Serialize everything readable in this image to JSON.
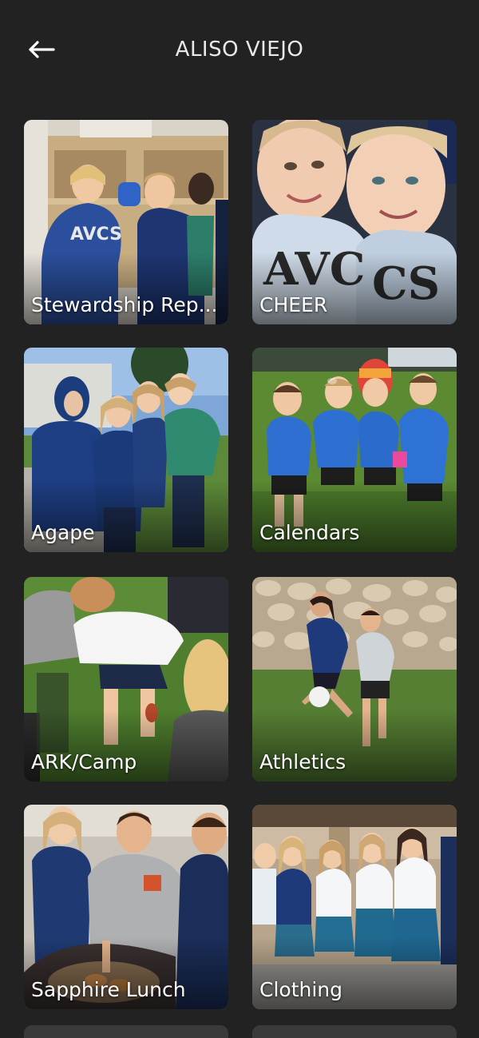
{
  "header": {
    "back_icon": "arrow-left-icon",
    "title": "ALISO VIEJO"
  },
  "tiles": [
    {
      "label": "Stewardship Rep..."
    },
    {
      "label": "CHEER"
    },
    {
      "label": "Agape"
    },
    {
      "label": "Calendars"
    },
    {
      "label": "ARK/Camp"
    },
    {
      "label": "Athletics"
    },
    {
      "label": "Sapphire Lunch"
    },
    {
      "label": "Clothing"
    }
  ],
  "colors": {
    "background": "#222222",
    "title_text": "#e9e9e9",
    "label_text": "#ffffff",
    "uniform_navy": "#1f3a73",
    "uniform_blue": "#2e6fd1",
    "grass_green": "#4f7f2e"
  }
}
